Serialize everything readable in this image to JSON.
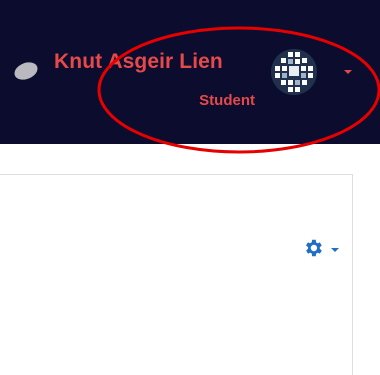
{
  "user_menu": {
    "name": "Knut Asgeir Lien",
    "role": "Student",
    "avatar_icon": "user-avatar-pattern",
    "caret_icon": "caret-down-icon"
  },
  "navbar": {
    "background_color": "#0b0c2e",
    "text_color": "#e54949",
    "message_icon": "chat-bubble-icon"
  },
  "content": {
    "actions_menu_icon": "gear-icon",
    "accent_color": "#1f6fc5"
  },
  "annotation": {
    "color": "#e60000",
    "shape": "ellipse"
  }
}
